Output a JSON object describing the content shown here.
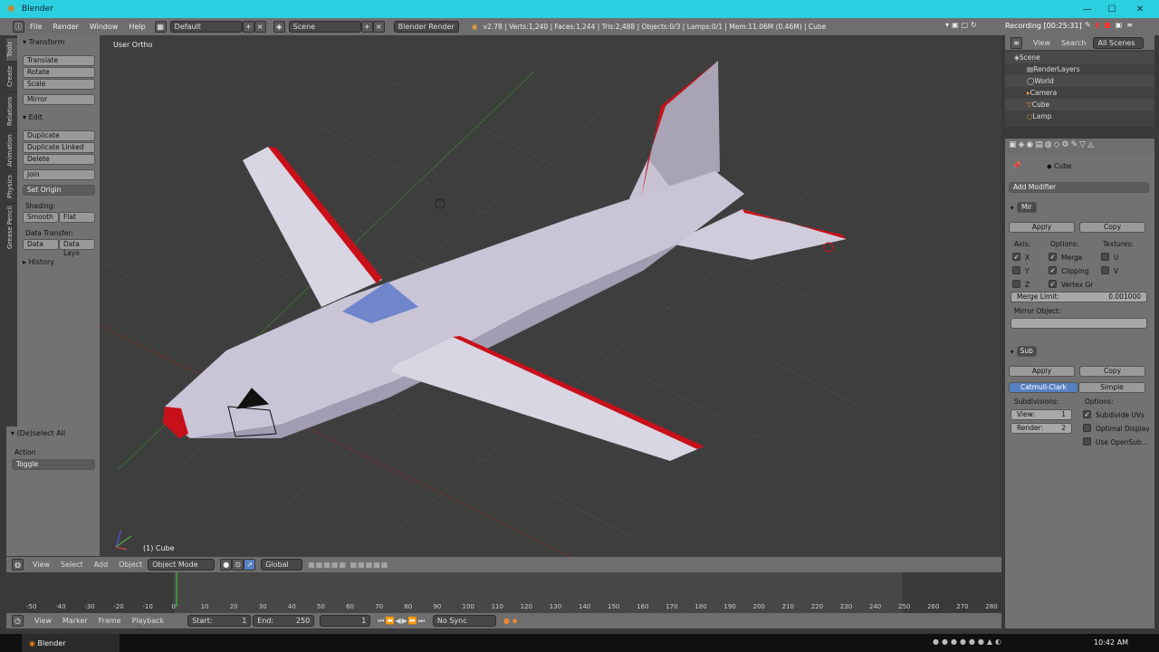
{
  "window": {
    "title": "Blender",
    "minimize": "—",
    "maximize": "☐",
    "close": "✕"
  },
  "info": {
    "menus": [
      "File",
      "Render",
      "Window",
      "Help"
    ],
    "layout": "Default",
    "scene": "Scene",
    "engine": "Blender Render",
    "stats": "v2.78 | Verts:1,240 | Faces:1,244 | Tris:2,488 | Objects:0/3 | Lamps:0/1 | Mem:11.06M (0.46M) | Cube",
    "recording": "Recording [00:25:31]"
  },
  "toolshelf": {
    "tabs": [
      "Tools",
      "Create",
      "Relations",
      "Animation",
      "Physics",
      "Grease Pencil"
    ],
    "transform_header": "Transform",
    "translate": "Translate",
    "rotate": "Rotate",
    "scale": "Scale",
    "mirror": "Mirror",
    "edit_header": "Edit",
    "duplicate": "Duplicate",
    "duplicate_linked": "Duplicate Linked",
    "delete": "Delete",
    "join": "Join",
    "set_origin": "Set Origin",
    "shading_label": "Shading:",
    "smooth": "Smooth",
    "flat": "Flat",
    "data_transfer_label": "Data Transfer:",
    "data": "Data",
    "data_layout": "Data Layo",
    "history": "History"
  },
  "operator": {
    "title": "(De)select All",
    "action_label": "Action",
    "action_value": "Toggle"
  },
  "viewport": {
    "view_label": "User Ortho",
    "object_label": "(1) Cube"
  },
  "v3d_header": {
    "view": "View",
    "select": "Select",
    "add": "Add",
    "object": "Object",
    "mode": "Object Mode",
    "orientation": "Global"
  },
  "timeline": {
    "ticks": [
      "-50",
      "-40",
      "-30",
      "-20",
      "-10",
      "0",
      "10",
      "20",
      "30",
      "40",
      "50",
      "60",
      "70",
      "80",
      "90",
      "100",
      "110",
      "120",
      "130",
      "140",
      "150",
      "160",
      "170",
      "180",
      "190",
      "200",
      "210",
      "220",
      "230",
      "240",
      "250",
      "260",
      "270",
      "280"
    ],
    "view": "View",
    "marker": "Marker",
    "frame": "Frame",
    "playback": "Playback",
    "start": "Start:",
    "start_val": "1",
    "end": "End:",
    "end_val": "250",
    "current": "1",
    "sync": "No Sync"
  },
  "outliner": {
    "view": "View",
    "search": "Search",
    "scope": "All Scenes",
    "items": [
      {
        "name": "Scene",
        "indent": 0
      },
      {
        "name": "RenderLayers",
        "indent": 1
      },
      {
        "name": "World",
        "indent": 1
      },
      {
        "name": "Camera",
        "indent": 1
      },
      {
        "name": "Cube",
        "indent": 1
      },
      {
        "name": "Lamp",
        "indent": 1
      }
    ]
  },
  "properties": {
    "object": "Cube",
    "add_modifier": "Add Modifier",
    "mirror": {
      "name": "Mir",
      "apply": "Apply",
      "copy": "Copy",
      "axis": "Axis:",
      "options": "Options:",
      "textures": "Textures:",
      "x": "X",
      "y": "Y",
      "z": "Z",
      "merge": "Merge",
      "clipping": "Clipping",
      "vertex_gr": "Vertex Gr",
      "u": "U",
      "v": "V",
      "merge_limit": "Merge Limit:",
      "merge_value": "0.001000",
      "mirror_object": "Mirror Object:"
    },
    "subsurf": {
      "name": "Sub",
      "apply": "Apply",
      "copy": "Copy",
      "catmull": "Catmull-Clark",
      "simple": "Simple",
      "subdivisions": "Subdivisions:",
      "options": "Options:",
      "view": "View:",
      "view_val": "1",
      "render": "Render:",
      "render_val": "2",
      "subdivide_uvs": "Subdivide UVs",
      "optimal_display": "Optimal Display",
      "use_opensub": "Use OpenSub..."
    }
  },
  "taskbar": {
    "app": "Blender",
    "time": "10:42 AM"
  },
  "colors": {
    "accent": "#5680c2",
    "airplane": "#c9c4d6",
    "stripe": "#c8101a",
    "title": "#2bcfe0"
  }
}
